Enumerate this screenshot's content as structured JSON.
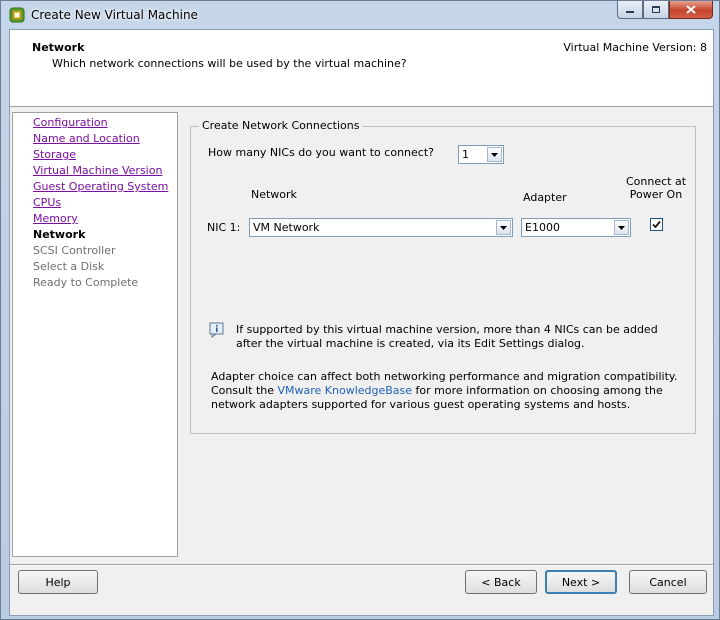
{
  "window": {
    "title": "Create New Virtual Machine"
  },
  "header": {
    "title": "Network",
    "subtitle": "Which network connections will be used by the virtual machine?",
    "version": "Virtual Machine Version: 8"
  },
  "steps": [
    {
      "label": "Configuration",
      "state": "done"
    },
    {
      "label": "Name and Location",
      "state": "done"
    },
    {
      "label": "Storage",
      "state": "done"
    },
    {
      "label": "Virtual Machine Version",
      "state": "done"
    },
    {
      "label": "Guest Operating System",
      "state": "done"
    },
    {
      "label": "CPUs",
      "state": "done"
    },
    {
      "label": "Memory",
      "state": "done"
    },
    {
      "label": "Network",
      "state": "current"
    },
    {
      "label": "SCSI Controller",
      "state": "future"
    },
    {
      "label": "Select a Disk",
      "state": "future"
    },
    {
      "label": "Ready to Complete",
      "state": "future"
    }
  ],
  "group": {
    "legend": "Create Network Connections",
    "nic_question": "How many NICs do you want to connect?",
    "nic_count": "1",
    "col_network": "Network",
    "col_adapter": "Adapter",
    "col_connect": "Connect at Power On",
    "nics": [
      {
        "label": "NIC 1:",
        "network": "VM Network",
        "adapter": "E1000",
        "connect": true
      }
    ],
    "info_text": "If supported by this virtual machine version, more than 4 NICs can be added after the virtual machine is created, via its Edit Settings dialog.",
    "adapter_text_before": "Adapter choice can affect both networking performance and migration compatibility. Consult the ",
    "kb_link": "VMware KnowledgeBase",
    "adapter_text_after": " for more information on choosing among the network adapters supported for various guest operating systems and hosts."
  },
  "buttons": {
    "help": "Help",
    "back": "< Back",
    "next": "Next >",
    "cancel": "Cancel"
  }
}
